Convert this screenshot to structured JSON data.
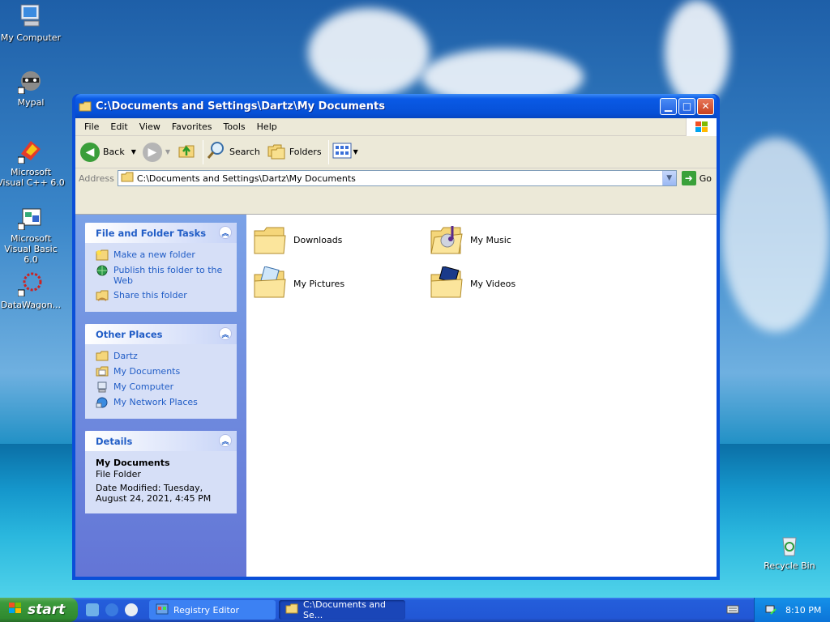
{
  "desktop": {
    "icons": [
      {
        "label": "My Computer"
      },
      {
        "label": "Mypal"
      },
      {
        "label": "Microsoft Visual C++ 6.0"
      },
      {
        "label": "Microsoft Visual Basic 6.0"
      },
      {
        "label": "DataWagon..."
      },
      {
        "label": "Recycle Bin"
      }
    ]
  },
  "window": {
    "title": "C:\\Documents and Settings\\Dartz\\My Documents",
    "menu": [
      "File",
      "Edit",
      "View",
      "Favorites",
      "Tools",
      "Help"
    ],
    "toolbar": {
      "back_label": "Back",
      "search_label": "Search",
      "folders_label": "Folders"
    },
    "address": {
      "label": "Address",
      "value": "C:\\Documents and Settings\\Dartz\\My Documents",
      "go_label": "Go"
    },
    "taskpane": {
      "file_tasks": {
        "title": "File and Folder Tasks",
        "items": [
          "Make a new folder",
          "Publish this folder to the Web",
          "Share this folder"
        ]
      },
      "other_places": {
        "title": "Other Places",
        "items": [
          "Dartz",
          "My Documents",
          "My Computer",
          "My Network Places"
        ]
      },
      "details": {
        "title": "Details",
        "name": "My Documents",
        "type": "File Folder",
        "modified": "Date Modified: Tuesday, August 24, 2021, 4:45 PM"
      }
    },
    "files": [
      {
        "name": "Downloads"
      },
      {
        "name": "My Music"
      },
      {
        "name": "My Pictures"
      },
      {
        "name": "My Videos"
      }
    ]
  },
  "taskbar": {
    "start_label": "start",
    "tasks": [
      {
        "label": "Registry Editor"
      },
      {
        "label": "C:\\Documents and Se..."
      }
    ],
    "clock": "8:10 PM"
  }
}
